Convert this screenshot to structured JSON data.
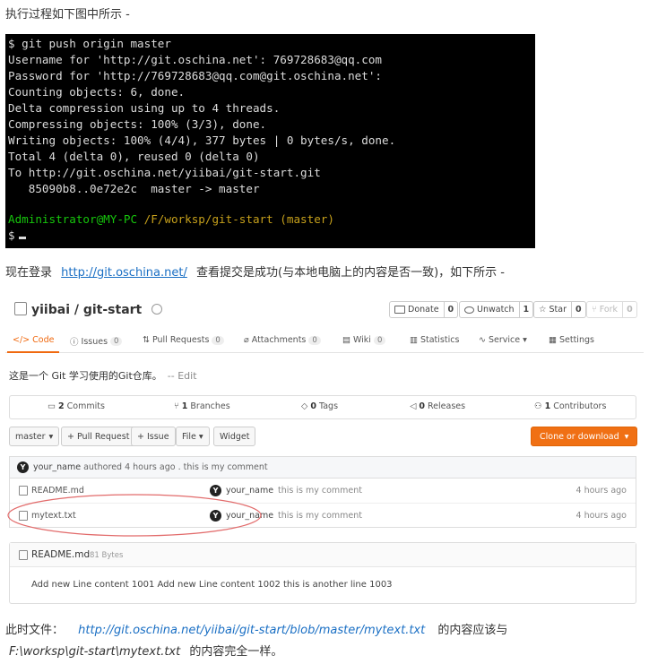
{
  "intro": "执行过程如下图中所示 -",
  "terminal": {
    "lines": [
      "$ git push origin master",
      "Username for 'http://git.oschina.net': 769728683@qq.com",
      "Password for 'http://769728683@qq.com@git.oschina.net':",
      "Counting objects: 6, done.",
      "Delta compression using up to 4 threads.",
      "Compressing objects: 100% (3/3), done.",
      "Writing objects: 100% (4/4), 377 bytes | 0 bytes/s, done.",
      "Total 4 (delta 0), reused 0 (delta 0)",
      "To http://git.oschina.net/yiibai/git-start.git",
      "   85090b8..0e72e2c  master -> master"
    ],
    "prompt_user": "Administrator@MY-PC",
    "prompt_path": " /F/worksp/git-start (master)",
    "prompt_symbol": "$"
  },
  "login": {
    "before": "现在登录",
    "link": "http://git.oschina.net/",
    "after": "查看提交是成功(与本地电脑上的内容是否一致)，如下所示 -"
  },
  "repo": {
    "title": "yiibai / git-start",
    "donate": {
      "label": "Donate",
      "count": "0"
    },
    "unwatch": {
      "label": "Unwatch",
      "count": "1"
    },
    "star": {
      "label": "Star",
      "count": "0"
    },
    "fork": {
      "label": "Fork",
      "count": "0"
    },
    "tabs": [
      {
        "label": "Code",
        "count": ""
      },
      {
        "label": "Issues",
        "count": "0"
      },
      {
        "label": "Pull Requests",
        "count": "0"
      },
      {
        "label": "Attachments",
        "count": "0"
      },
      {
        "label": "Wiki",
        "count": "0"
      },
      {
        "label": "Statistics",
        "count": ""
      },
      {
        "label": "Service",
        "count": ""
      },
      {
        "label": "Settings",
        "count": ""
      }
    ],
    "description": "这是一个 Git 学习使用的Git仓库。",
    "edit": "-- Edit",
    "stats": {
      "commits": {
        "n": "2",
        "label": "Commits"
      },
      "branches": {
        "n": "1",
        "label": "Branches"
      },
      "tags": {
        "n": "0",
        "label": "Tags"
      },
      "releases": {
        "n": "0",
        "label": "Releases"
      },
      "contributors": {
        "n": "1",
        "label": "Contributors"
      }
    },
    "buttons": {
      "branch": "master",
      "pull_request": "+ Pull Request",
      "issue": "+ Issue",
      "file": "File",
      "widget": "Widget",
      "clone": "Clone or download"
    },
    "last_commit": {
      "author": "your_name",
      "text": "authored 4 hours ago . this is my comment"
    },
    "files": [
      {
        "name": "README.md",
        "author": "your_name",
        "message": "this is my comment",
        "time": "4 hours ago"
      },
      {
        "name": "mytext.txt",
        "author": "your_name",
        "message": "this is my comment",
        "time": "4 hours ago"
      }
    ],
    "readme": {
      "name": "README.md",
      "size": "81 Bytes",
      "content": "Add new Line content 1001 Add new Line content 1002 this is another line 1003"
    }
  },
  "footer": {
    "prefix": "此时文件：",
    "link": "http://git.oschina.net/yiibai/git-start/blob/master/mytext.txt",
    "middle": "的内容应该与",
    "path": "F:\\worksp\\git-start\\mytext.txt",
    "suffix": "的内容完全一样。"
  }
}
